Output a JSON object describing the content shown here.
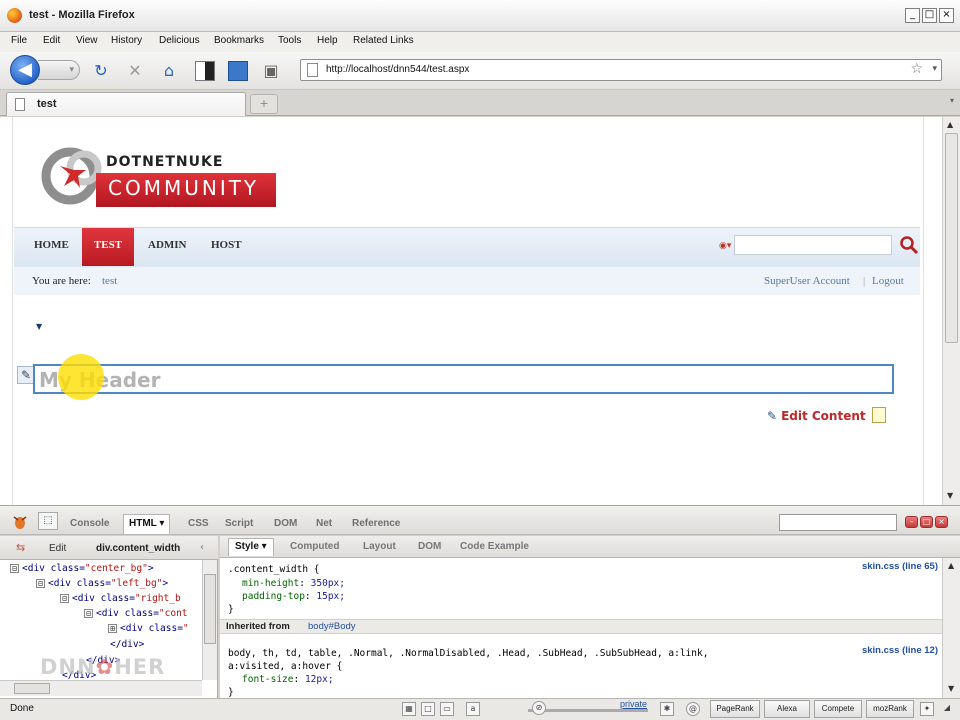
{
  "window": {
    "title": "test - Mozilla Firefox",
    "controls": [
      "_",
      "□",
      "×"
    ]
  },
  "menubar": {
    "items": [
      "File",
      "Edit",
      "View",
      "History",
      "Delicious",
      "Bookmarks",
      "Tools",
      "Help",
      "Related Links"
    ]
  },
  "navbar": {
    "url": "http://localhost/dnn544/test.aspx",
    "icons": [
      "back-icon",
      "forward-icon",
      "reload-icon",
      "stop-icon",
      "home-icon",
      "delicious-icon",
      "panel-icon",
      "tag-icon",
      "star-icon"
    ]
  },
  "tabs": [
    {
      "label": "test"
    }
  ],
  "site": {
    "logo_top": "DOTNETNUKE",
    "logo_bottom": "COMMUNITY",
    "nav": [
      "HOME",
      "TEST",
      "ADMIN",
      "HOST"
    ],
    "active_nav": "TEST",
    "breadcrumb_label": "You are here:",
    "breadcrumb_link": "test",
    "account_link": "SuperUser Account",
    "separator": "|",
    "logout_link": "Logout",
    "header_text": "My Header",
    "edit_content": "Edit Content"
  },
  "firebug": {
    "tabs": [
      "Console",
      "HTML ▾",
      "CSS",
      "Script",
      "DOM",
      "Net",
      "Reference"
    ],
    "active_tab": "HTML ▾",
    "left_head": {
      "edit": "Edit",
      "crumb": "div.content_width"
    },
    "html_lines": [
      {
        "toggle": "⊟",
        "tag": "<div class=",
        "attr": "\"center_bg\"",
        "end": ">"
      },
      {
        "toggle": "⊟",
        "tag": "<div class=",
        "attr": "\"left_bg\"",
        "end": ">"
      },
      {
        "toggle": "⊟",
        "tag": "<div class=",
        "attr": "\"right_b",
        "end": ""
      },
      {
        "toggle": "⊟",
        "tag": "<div class=",
        "attr": "\"cont",
        "end": ""
      },
      {
        "toggle": "⊞",
        "tag": "<div class=",
        "attr": "\"",
        "end": ""
      },
      {
        "toggle": "",
        "tag": "</div>",
        "attr": "",
        "end": ""
      },
      {
        "toggle": "",
        "tag": "</div>",
        "attr": "",
        "end": ""
      },
      {
        "toggle": "",
        "tag": "</div>",
        "attr": "",
        "end": ""
      }
    ],
    "right_tabs": [
      "Style ▾",
      "Computed",
      "Layout",
      "DOM",
      "Code Example"
    ],
    "active_right_tab": "Style ▾",
    "rule1": {
      "selector": ".content_width {",
      "props": [
        {
          "name": "min-height",
          "value": "350px;"
        },
        {
          "name": "padding-top",
          "value": "15px;"
        }
      ],
      "close": "}",
      "source": "skin.css (line 65)"
    },
    "inherited_label": "Inherited from",
    "inherited_selector": "body#Body",
    "rule2": {
      "selector_line1": "body, th, td, table, .Normal, .NormalDisabled, .Head, .SubHead, .SubSubHead, a:link,",
      "selector_line2": "a:visited, a:hover {",
      "props": [
        {
          "name": "font-size",
          "value": "12px;"
        }
      ],
      "close": "}",
      "source": "skin.css (line 12)"
    }
  },
  "watermark": {
    "part1": "DNN",
    "part2": "HER"
  },
  "statusbar": {
    "text": "Done",
    "private": "private",
    "buttons": [
      "PageRank",
      "Alexa",
      "Compete",
      "mozRank"
    ]
  }
}
